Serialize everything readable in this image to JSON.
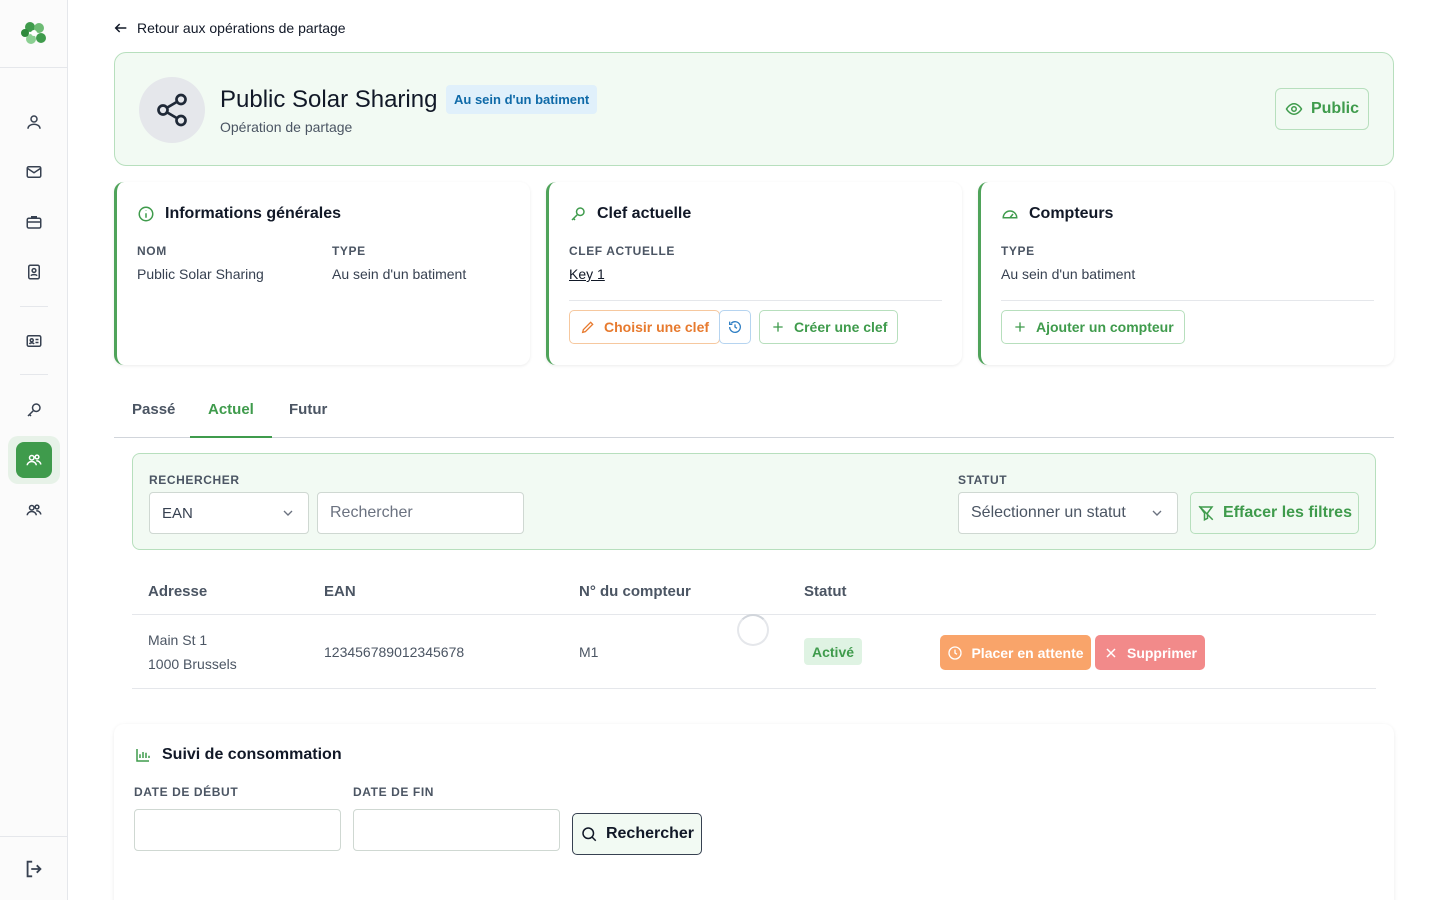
{
  "nav": {
    "back_label": "Retour aux opérations de partage"
  },
  "header": {
    "title": "Public Solar Sharing",
    "badge": "Au sein d'un batiment",
    "subtitle": "Opération de partage",
    "visibility_label": "Public"
  },
  "general_info": {
    "title": "Informations générales",
    "name_label": "NOM",
    "name_value": "Public Solar Sharing",
    "type_label": "TYPE",
    "type_value": "Au sein d'un batiment"
  },
  "current_key": {
    "title": "Clef actuelle",
    "key_label": "CLEF ACTUELLE",
    "key_value": "Key 1",
    "choose_label": "Choisir une clef",
    "create_label": "Créer une clef"
  },
  "meters": {
    "title": "Compteurs",
    "type_label": "TYPE",
    "type_value": "Au sein d'un batiment",
    "add_label": "Ajouter un compteur"
  },
  "tabs": [
    {
      "label": "Passé"
    },
    {
      "label": "Actuel"
    },
    {
      "label": "Futur"
    }
  ],
  "filters": {
    "search_label": "RECHERCHER",
    "search_field_value": "EAN",
    "search_placeholder": "Rechercher",
    "status_label": "STATUT",
    "status_placeholder": "Sélectionner un statut",
    "clear_label": "Effacer les filtres"
  },
  "table": {
    "headers": [
      "Adresse",
      "EAN",
      "N° du compteur",
      "Statut"
    ],
    "rows": [
      {
        "address_line1": "Main St 1",
        "address_line2": "1000 Brussels",
        "ean": "123456789012345678",
        "meter_number": "M1",
        "status": "Activé",
        "hold_label": "Placer en attente",
        "delete_label": "Supprimer"
      }
    ]
  },
  "consumption": {
    "title": "Suivi de consommation",
    "start_label": "DATE DE DÉBUT",
    "end_label": "DATE DE FIN",
    "search_label": "Rechercher"
  },
  "colors": {
    "brand_green": "#3f9b4c",
    "light_green_bg": "#f2faf3",
    "badge_blue": "#0f6aa8",
    "warn_orange": "#f9a46a",
    "danger_red": "#f28a8a"
  }
}
